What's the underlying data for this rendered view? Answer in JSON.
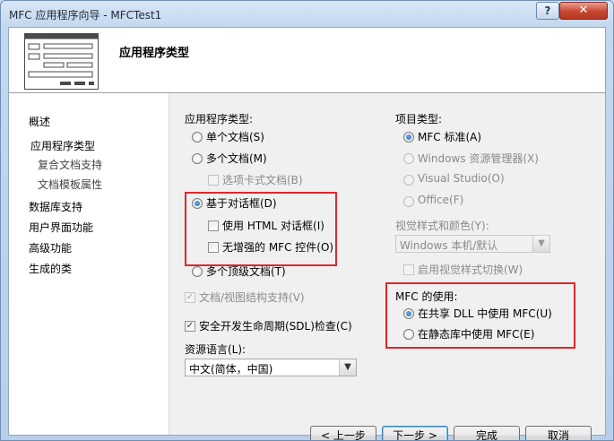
{
  "window": {
    "title": "MFC 应用程序向导 - MFCTest1",
    "help_label": "?",
    "close_label": "✕"
  },
  "header": {
    "title": "应用程序类型"
  },
  "nav": {
    "items": [
      "概述",
      "应用程序类型",
      "复合文档支持",
      "文档模板属性",
      "数据库支持",
      "用户界面功能",
      "高级功能",
      "生成的类"
    ]
  },
  "app_type": {
    "label": "应用程序类型:",
    "single_doc": "单个文档(S)",
    "multi_doc": "多个文档(M)",
    "tabbed_docs": "选项卡式文档(B)",
    "dialog_based": "基于对话框(D)",
    "use_html_dialog": "使用 HTML 对话框(I)",
    "no_enhanced_mfc": "无增强的 MFC 控件(O)",
    "multi_toplevel": "多个顶级文档(T)",
    "doc_view_support": "文档/视图结构支持(V)",
    "sdl_check": "安全开发生命周期(SDL)检查(C)"
  },
  "resource_lang": {
    "label": "资源语言(L):",
    "value": "中文(简体，中国)"
  },
  "project_type": {
    "label": "项目类型:",
    "mfc_standard": "MFC 标准(A)",
    "win_explorer": "Windows 资源管理器(X)",
    "visual_studio": "Visual Studio(O)",
    "office": "Office(F)"
  },
  "visual_style": {
    "label": "视觉样式和颜色(Y):",
    "value": "Windows 本机/默认",
    "enable_switch": "启用视觉样式切换(W)"
  },
  "mfc_use": {
    "label": "MFC 的使用:",
    "shared_dll": "在共享 DLL 中使用 MFC(U)",
    "static_lib": "在静态库中使用 MFC(E)"
  },
  "buttons": {
    "prev": "< 上一步",
    "next": "下一步 >",
    "finish": "完成",
    "cancel": "取消"
  }
}
